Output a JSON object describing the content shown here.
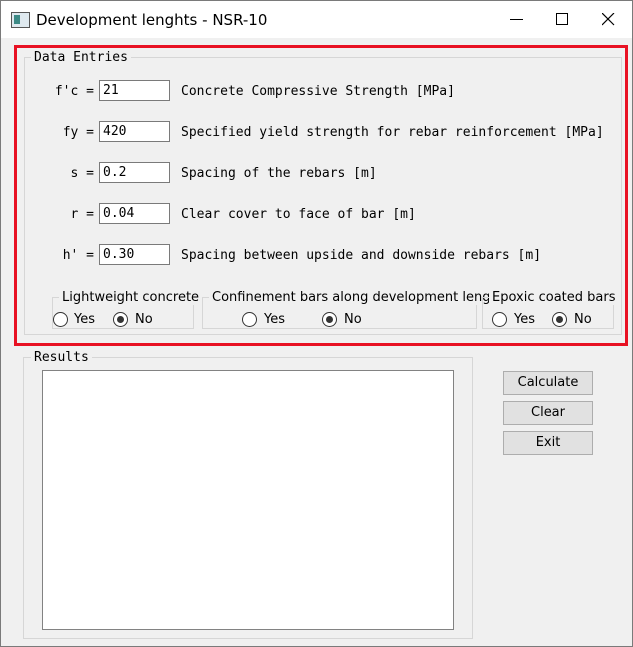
{
  "window": {
    "title": "Development lenghts - NSR-10"
  },
  "data_entries": {
    "legend": "Data Entries",
    "fields": [
      {
        "label": "f'c =",
        "value": "21",
        "description": "Concrete Compressive Strength [MPa]"
      },
      {
        "label": "fy =",
        "value": "420",
        "description": "Specified yield strength for rebar reinforcement [MPa]"
      },
      {
        "label": "s =",
        "value": "0.2",
        "description": "Spacing of the rebars [m]"
      },
      {
        "label": "r =",
        "value": "0.04",
        "description": "Clear cover to face of bar [m]"
      },
      {
        "label": "h' =",
        "value": "0.30",
        "description": "Spacing between upside and downside rebars [m]"
      }
    ],
    "options": [
      {
        "title": "Lightweight concrete",
        "yes_label": "Yes",
        "no_label": "No",
        "selected": "No"
      },
      {
        "title": "Confinement bars along development length",
        "yes_label": "Yes",
        "no_label": "No",
        "selected": "No"
      },
      {
        "title": "Epoxic coated bars",
        "yes_label": "Yes",
        "no_label": "No",
        "selected": "No"
      }
    ]
  },
  "results": {
    "legend": "Results",
    "text": ""
  },
  "buttons": {
    "calculate": "Calculate",
    "clear": "Clear",
    "exit": "Exit"
  },
  "colors": {
    "highlight": "#e81123",
    "background": "#f0f0f0"
  }
}
